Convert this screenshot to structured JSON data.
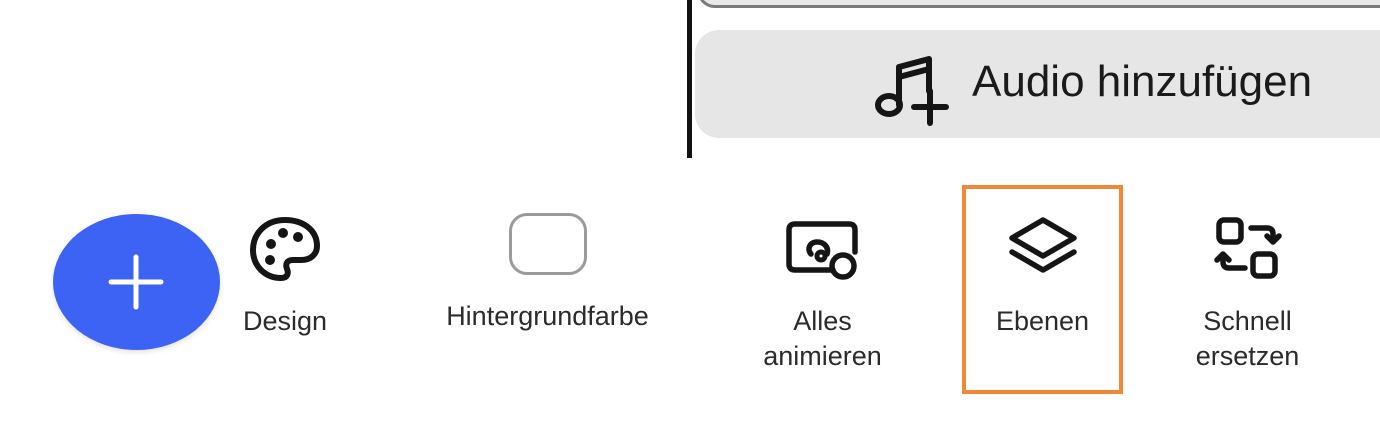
{
  "audio_bar": {
    "label": "Audio hinzufügen",
    "icon": "music-note-plus-icon"
  },
  "fab": {
    "icon": "plus-icon",
    "color": "#3d63f5"
  },
  "toolbar": {
    "items": [
      {
        "label": "Design",
        "icon": "palette-icon"
      },
      {
        "label": "Hintergrundfarbe",
        "icon": "color-swatch-icon"
      },
      {
        "label": "Alles\nanimieren",
        "icon": "animate-all-icon"
      },
      {
        "label": "Ebenen",
        "icon": "layers-icon",
        "highlighted": true
      },
      {
        "label": "Schnell\nersetzen",
        "icon": "quick-replace-icon"
      }
    ],
    "highlight_color": "#f08838"
  }
}
